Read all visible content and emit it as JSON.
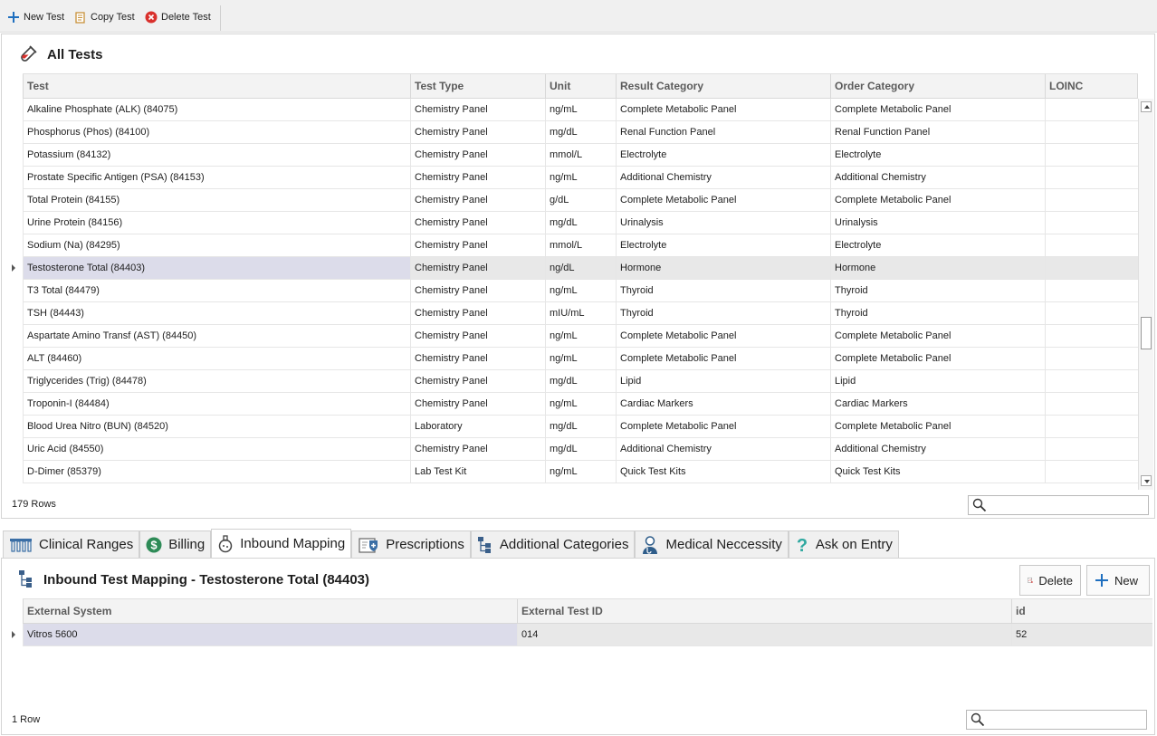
{
  "toolbar": {
    "new_label": "New Test",
    "copy_label": "Copy Test",
    "delete_label": "Delete Test"
  },
  "all_tests": {
    "title": "All Tests",
    "columns": [
      "Test",
      "Test Type",
      "Unit",
      "Result Category",
      "Order Category",
      "LOINC"
    ],
    "rows": [
      [
        "Alkaline Phosphate (ALK) (84075)",
        "Chemistry Panel",
        "ng/mL",
        "Complete Metabolic Panel",
        "Complete Metabolic Panel",
        ""
      ],
      [
        "Phosphorus (Phos) (84100)",
        "Chemistry Panel",
        "mg/dL",
        "Renal Function Panel",
        "Renal Function Panel",
        ""
      ],
      [
        "Potassium (84132)",
        "Chemistry Panel",
        "mmol/L",
        "Electrolyte",
        "Electrolyte",
        ""
      ],
      [
        "Prostate Specific Antigen (PSA) (84153)",
        "Chemistry Panel",
        "ng/mL",
        "Additional Chemistry",
        "Additional Chemistry",
        ""
      ],
      [
        "Total Protein (84155)",
        "Chemistry Panel",
        "g/dL",
        "Complete Metabolic Panel",
        "Complete Metabolic Panel",
        ""
      ],
      [
        "Urine Protein (84156)",
        "Chemistry Panel",
        "mg/dL",
        "Urinalysis",
        "Urinalysis",
        ""
      ],
      [
        "Sodium (Na) (84295)",
        "Chemistry Panel",
        "mmol/L",
        "Electrolyte",
        "Electrolyte",
        ""
      ],
      [
        "Testosterone Total (84403)",
        "Chemistry Panel",
        "ng/dL",
        "Hormone",
        "Hormone",
        ""
      ],
      [
        "T3 Total (84479)",
        "Chemistry Panel",
        "ng/mL",
        "Thyroid",
        "Thyroid",
        ""
      ],
      [
        "TSH (84443)",
        "Chemistry Panel",
        "mIU/mL",
        "Thyroid",
        "Thyroid",
        ""
      ],
      [
        "Aspartate Amino Transf (AST) (84450)",
        "Chemistry Panel",
        "ng/mL",
        "Complete Metabolic Panel",
        "Complete Metabolic Panel",
        ""
      ],
      [
        "ALT (84460)",
        "Chemistry Panel",
        "ng/mL",
        "Complete Metabolic Panel",
        "Complete Metabolic Panel",
        ""
      ],
      [
        "Triglycerides (Trig) (84478)",
        "Chemistry Panel",
        "mg/dL",
        "Lipid",
        "Lipid",
        ""
      ],
      [
        "Troponin-I (84484)",
        "Chemistry Panel",
        "ng/mL",
        "Cardiac Markers",
        "Cardiac Markers",
        ""
      ],
      [
        "Blood Urea Nitro (BUN) (84520)",
        "Laboratory",
        "mg/dL",
        "Complete Metabolic Panel",
        "Complete Metabolic Panel",
        ""
      ],
      [
        "Uric Acid (84550)",
        "Chemistry Panel",
        "mg/dL",
        "Additional Chemistry",
        "Additional Chemistry",
        ""
      ],
      [
        "D-Dimer (85379)",
        "Lab Test Kit",
        "ng/mL",
        "Quick Test Kits",
        "Quick Test Kits",
        ""
      ]
    ],
    "selected_row": 7,
    "row_count": "179 Rows",
    "search_value": ""
  },
  "tabs": [
    {
      "label": "Clinical Ranges",
      "icon": "test-tubes-icon"
    },
    {
      "label": "Billing",
      "icon": "dollar-icon"
    },
    {
      "label": "Inbound Mapping",
      "icon": "flask-icon"
    },
    {
      "label": "Prescriptions",
      "icon": "prescription-icon"
    },
    {
      "label": "Additional Categories",
      "icon": "hierarchy-icon"
    },
    {
      "label": "Medical Neccessity",
      "icon": "doctor-icon"
    },
    {
      "label": "Ask on Entry",
      "icon": "question-icon"
    }
  ],
  "active_tab": 2,
  "mapping": {
    "title": "Inbound Test Mapping - Testosterone Total (84403)",
    "delete_label": "Delete",
    "new_label": "New",
    "columns": [
      "External System",
      "External Test ID",
      "id"
    ],
    "rows": [
      [
        "Vitros 5600",
        "014",
        "52"
      ]
    ],
    "row_count": "1 Row",
    "search_value": ""
  },
  "colors": {
    "accent": "#5d5a8e",
    "new_icon": "#1f6fbf",
    "delete_icon": "#d9302c",
    "billing_icon": "#2e8b57",
    "question_icon": "#2fa8a0",
    "selected_row": "#e8e8e8"
  }
}
